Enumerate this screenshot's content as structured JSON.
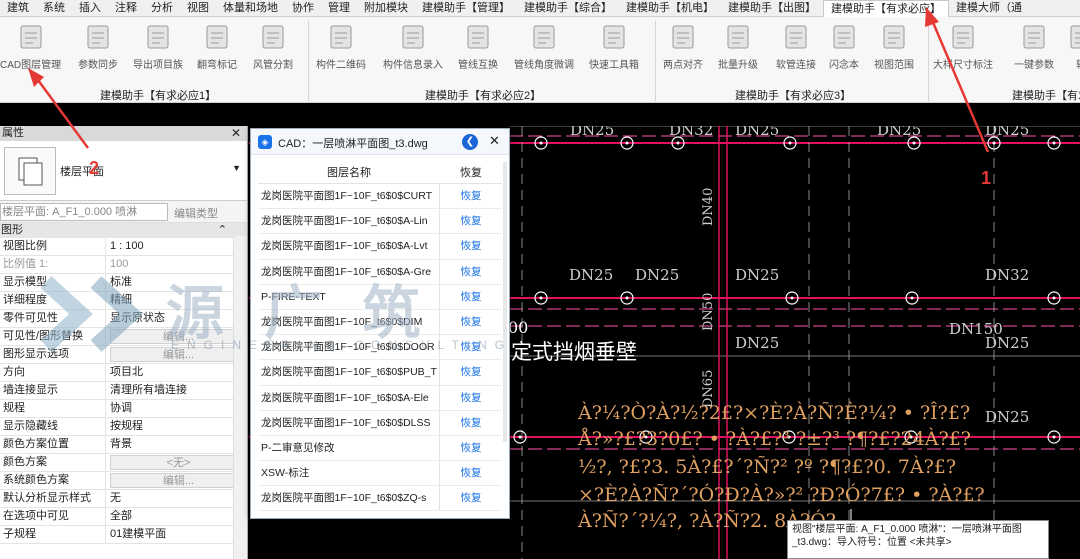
{
  "ribbon": {
    "tabs": [
      "建筑",
      "系统",
      "插入",
      "注释",
      "分析",
      "视图",
      "体量和场地",
      "协作",
      "管理",
      "附加模块",
      "建模助手【管理】",
      "建模助手【综合】",
      "建模助手【机电】",
      "建模助手【出图】",
      "建模助手【有求必应】",
      "建模大师（通"
    ],
    "active_tab_index": 14,
    "buttons": [
      {
        "label": "CAD图层管理",
        "icon": "cad-layers-icon"
      },
      {
        "label": "参数同步",
        "icon": "param-sync-icon"
      },
      {
        "label": "导出项目族",
        "icon": "export-family-icon"
      },
      {
        "label": "翻弯标记",
        "icon": "bend-mark-icon"
      },
      {
        "label": "风管分割",
        "icon": "duct-split-icon"
      },
      {
        "label": "构件二维码",
        "icon": "qrcode-icon"
      },
      {
        "label": "构件信息录入",
        "icon": "info-entry-icon"
      },
      {
        "label": "管线互换",
        "icon": "pipe-swap-icon"
      },
      {
        "label": "管线角度微调",
        "icon": "angle-adjust-icon"
      },
      {
        "label": "快速工具箱",
        "icon": "toolbox-icon"
      },
      {
        "label": "两点对齐",
        "icon": "align-icon"
      },
      {
        "label": "批量升级",
        "icon": "upgrade-icon"
      },
      {
        "label": "软管连接",
        "icon": "hose-icon"
      },
      {
        "label": "闪念本",
        "icon": "notebook-icon"
      },
      {
        "label": "视图范围",
        "icon": "view-range-icon"
      },
      {
        "label": "大样尺寸标注",
        "icon": "dimension-icon"
      },
      {
        "label": "一键参数",
        "icon": "one-click-param-icon"
      },
      {
        "label": "轴",
        "icon": "axis-icon"
      }
    ],
    "panels": [
      "建模助手【有求必应1】",
      "建模助手【有求必应2】",
      "建模助手【有求必应3】",
      "建模助手【有求必应"
    ]
  },
  "properties": {
    "title": "属性",
    "close": "✕",
    "type_name": "楼层平面",
    "view_selector": "楼层平面: A_F1_0.000 喷淋",
    "edit_type": "编辑类型",
    "section": "图形",
    "rows": [
      {
        "k": "视图比例",
        "v": "1 : 100",
        "dim": false,
        "btn": false
      },
      {
        "k": "比例值 1:",
        "v": "100",
        "dim": true,
        "btn": false
      },
      {
        "k": "显示模型",
        "v": "标准",
        "dim": false,
        "btn": false
      },
      {
        "k": "详细程度",
        "v": "精细",
        "dim": false,
        "btn": false
      },
      {
        "k": "零件可见性",
        "v": "显示原状态",
        "dim": false,
        "btn": false
      },
      {
        "k": "可见性/图形替换",
        "v": "编辑...",
        "dim": false,
        "btn": true
      },
      {
        "k": "图形显示选项",
        "v": "编辑...",
        "dim": false,
        "btn": true
      },
      {
        "k": "方向",
        "v": "项目北",
        "dim": false,
        "btn": false
      },
      {
        "k": "墙连接显示",
        "v": "清理所有墙连接",
        "dim": false,
        "btn": false
      },
      {
        "k": "规程",
        "v": "协调",
        "dim": false,
        "btn": false
      },
      {
        "k": "显示隐藏线",
        "v": "按规程",
        "dim": false,
        "btn": false
      },
      {
        "k": "颜色方案位置",
        "v": "背景",
        "dim": false,
        "btn": false
      },
      {
        "k": "颜色方案",
        "v": "<无>",
        "dim": false,
        "btn": true
      },
      {
        "k": "系统颜色方案",
        "v": "编辑...",
        "dim": false,
        "btn": true
      },
      {
        "k": "默认分析显示样式",
        "v": "无",
        "dim": false,
        "btn": false
      },
      {
        "k": "在选项中可见",
        "v": "全部",
        "dim": false,
        "btn": false
      },
      {
        "k": "子规程",
        "v": "01建模平面",
        "dim": false,
        "btn": false
      }
    ]
  },
  "cad_dialog": {
    "title": "CAD：一层喷淋平面图_t3.dwg",
    "col_layer": "图层名称",
    "col_restore": "恢复",
    "layers": [
      {
        "name": "龙岗医院平面图1F~10F_t6$0$CURT",
        "action": "恢复"
      },
      {
        "name": "龙岗医院平面图1F~10F_t6$0$A-Lin",
        "action": "恢复"
      },
      {
        "name": "龙岗医院平面图1F~10F_t6$0$A-Lvt",
        "action": "恢复"
      },
      {
        "name": "龙岗医院平面图1F~10F_t6$0$A-Gre",
        "action": "恢复"
      },
      {
        "name": "P-FIRE-TEXT",
        "action": "恢复"
      },
      {
        "name": "龙岗医院平面图1F~10F_t6$0$DIM",
        "action": "恢复"
      },
      {
        "name": "龙岗医院平面图1F~10F_t6$0$DOOR",
        "action": "恢复"
      },
      {
        "name": "龙岗医院平面图1F~10F_t6$0$PUB_T",
        "action": "恢复"
      },
      {
        "name": "龙岗医院平面图1F~10F_t6$0$A-Ele",
        "action": "恢复"
      },
      {
        "name": "龙岗医院平面图1F~10F_t6$0$DLSS",
        "action": "恢复"
      },
      {
        "name": "P-二审意见修改",
        "action": "恢复"
      },
      {
        "name": "XSW-标注",
        "action": "恢复"
      },
      {
        "name": "龙岗医院平面图1F~10F_t6$0$ZQ-s",
        "action": "恢复"
      }
    ]
  },
  "canvas": {
    "labels": [
      "DN25",
      "DN32",
      "DN25",
      "DN25",
      "DN25",
      "DN25",
      "DN25",
      "DN25",
      "DN32",
      "DN25",
      "DN25",
      "DN150",
      "DN25"
    ],
    "vertical_labels": [
      "DN40",
      "DN50",
      "DN65"
    ],
    "caption": "定式挡烟垂壁",
    "partial_digits": "00",
    "garbled": [
      "À?¼?Ò?À?½?2£?×?È?À?Ñ?È?¼? • ?Î?£?",
      "Å?»?£?3?0£? • ?À?£?³ ?±?³ ?¶?£?24À?£?",
      "½?, ?£?3. 5À?£?´?Ñ?² ?º ?¶?£?0. 7À?£?",
      "×?È?À?Ñ?´?Ó?Ð?À?»?² ?Ð?Ó?7£? • ?À?£?",
      "À?Ñ?´?¼?, ?À?Ñ?2. 8À?Ó?"
    ],
    "colors": {
      "pipe": "#e0115f",
      "text": "#e0a060",
      "grid": "#ffffff",
      "dim": "#ff55aa"
    }
  },
  "watermark": {
    "big": "源 广 筑",
    "small": "ENGINEERING CONSULTING"
  },
  "annotations": {
    "one": "1",
    "two": "2"
  },
  "tooltip": {
    "text": "视图\"楼层平面: A_F1_0.000 喷淋\"：一层喷淋平面图_t3.dwg：导入符号：位置 <未共享>"
  }
}
